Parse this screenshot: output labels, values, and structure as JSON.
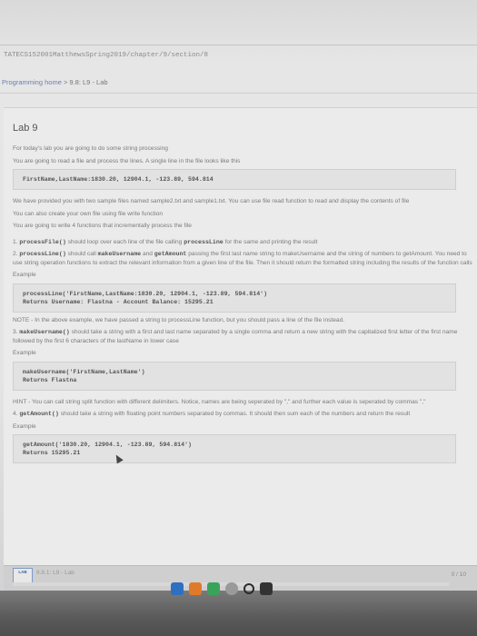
{
  "browser": {
    "url": "TATECS152001MatthewsSpring2019/chapter/9/section/8"
  },
  "breadcrumb": {
    "home": "Programming home",
    "sep": " > ",
    "section": "9.8: L9 - Lab"
  },
  "lab": {
    "title": "Lab 9",
    "intro1": "For today's lab you are going to do some string processing",
    "intro2": "You are going to read a file and process the lines. A single line in the file looks like this",
    "sample_line": "FirstName,LastName:1830.20, 12904.1, -123.89, 594.814",
    "provided": "We have provided you with two sample files named sample2.txt and sample1.txt. You can use file read function to read and display the contents of file",
    "create_own": "You can also create your own file using file write function",
    "write4": "You are going to write 4 functions that incrementally process the file",
    "step1_num": "1. ",
    "step1_fn": "processFile()",
    "step1_a": " should loop over each line of the file calling ",
    "step1_fn2": "processLine",
    "step1_b": " for the same and printing the result",
    "step2_num": "2. ",
    "step2_fn": "processLine()",
    "step2_a": " should call ",
    "step2_fn2": "makeUsername",
    "step2_b": " and ",
    "step2_fn3": "getAmount",
    "step2_c": " passing the first last name string to makeUsername and the string of numbers to getAmount. You need to use string operation functions to extract the relevant information from a given line of the file. Then it should return the formatted string including the results of the function calls",
    "example_label": "Example",
    "example1_line1": "processLine('FirstName,LastName:1830.20, 12904.1, -123.89, 594.814')",
    "example1_line2": "Returns Username: Flastna - Account Balance: 15295.21",
    "note": "NOTE - In the above example, we have passed a string to processLine function, but you should pass a line of the file instead.",
    "step3_num": "3. ",
    "step3_fn": "makeUsername()",
    "step3_a": " should take a string with a first and last name separated by a single comma and return a new string with the capitalized first letter of the first name followed by the first 6 characters of the lastName in lower case",
    "example2_line1": "makeUsername('FirstName,LastName')",
    "example2_line2": "Returns Flastna",
    "hint": "HINT - You can call string split function with different delimiters. Notice, names are being seperated by \",\" and further each value is seperated by commas \",\"",
    "step4_num": "4. ",
    "step4_fn": "getAmount()",
    "step4_a": " should take a string with floating point numbers separated by commas. It should then sum each of the numbers and return the result",
    "example3_line1": "getAmount('1830.20, 12904.1, -123.89, 594.814')",
    "example3_line2": "Returns 15295.21"
  },
  "footer": {
    "lab_tag": "LAB",
    "activity": "9.8.1: L9 - Lab",
    "score": "0 / 10",
    "progress": 0.0
  },
  "colors": {
    "accent": "#6a7fb0",
    "code_bg": "#e2e2e2"
  }
}
